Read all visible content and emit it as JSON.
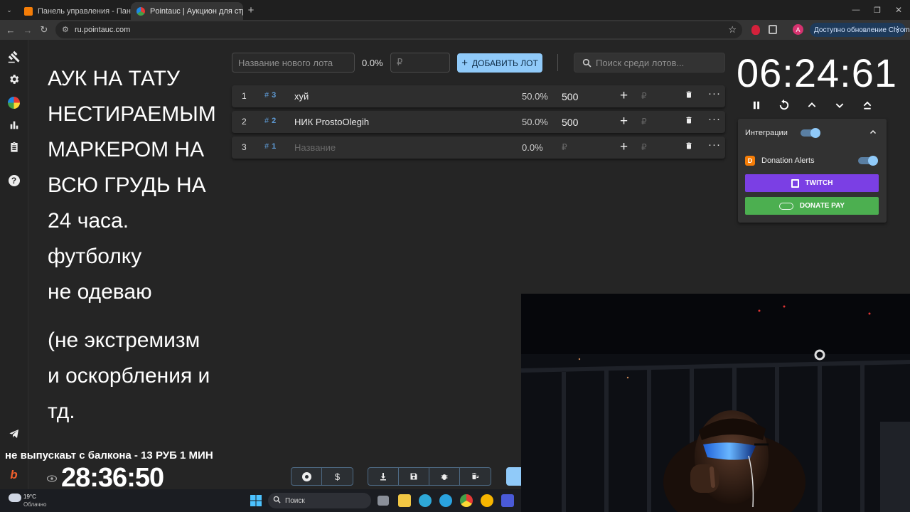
{
  "browser": {
    "tabs": [
      {
        "title": "Панель управления - Панель",
        "active": false
      },
      {
        "title": "Pointauc | Аукцион для стрим",
        "active": true
      }
    ],
    "url": "ru.pointauc.com",
    "update_label": "Доступно обновление Chrome",
    "new_tab_symbol": "+"
  },
  "overlay": {
    "lines": [
      "АУК НА ТАТУ",
      "НЕСТИРАЕМЫМ",
      "МАРКЕРОМ НА",
      "ВСЮ ГРУДЬ НА",
      "24 часа.",
      "футболку",
      "не одеваю",
      "",
      "(не экстремизм",
      "и оскорбления и",
      "тд."
    ]
  },
  "toolbar": {
    "new_lot_placeholder": "Название нового лота",
    "percent": "0.0%",
    "amount_placeholder": "₽",
    "add_lot_label": "ДОБАВИТЬ ЛОТ",
    "search_placeholder": "Поиск среди лотов..."
  },
  "lots": [
    {
      "index": "1",
      "tag": "3",
      "name": "хуй",
      "percent": "50.0%",
      "amount": "500",
      "currency": "₽"
    },
    {
      "index": "2",
      "tag": "2",
      "name": "НИК ProstoOlegih",
      "percent": "50.0%",
      "amount": "500",
      "currency": "₽"
    },
    {
      "index": "3",
      "tag": "1",
      "name": "Название",
      "percent": "0.0%",
      "amount": "₽",
      "currency": "₽"
    }
  ],
  "timer": {
    "value": "06:24:61"
  },
  "integrations": {
    "title": "Интеграции",
    "donation_alerts_label": "Donation Alerts",
    "twitch_label": "TWITCH",
    "donatepay_label": "DONATE PAY",
    "twitch_color": "#7b3fe4",
    "donatepay_color": "#4caf50"
  },
  "stream": {
    "ticker": "не выпускаьт с балкона - 13 РУБ 1 МИН",
    "countdown": "28:36:50"
  },
  "taskbar": {
    "weather_temp": "19°C",
    "weather_desc": "Облачно",
    "search_label": "Поиск"
  },
  "colors": {
    "accent": "#90caf9",
    "background": "#252525",
    "row": "#2e2e2e"
  }
}
